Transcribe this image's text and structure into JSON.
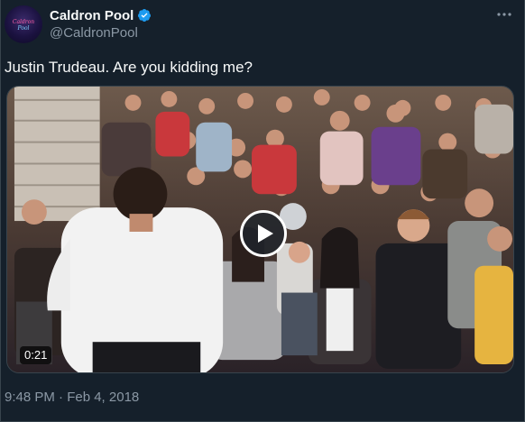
{
  "account": {
    "display_name": "Caldron Pool",
    "handle": "@CaldronPool",
    "avatar_logo_text": "Caldron Pool",
    "verified_icon": "verified-badge-icon"
  },
  "tweet": {
    "text": "Justin Trudeau. Are you kidding me?",
    "more_icon": "more-options-icon"
  },
  "video": {
    "duration": "0:21",
    "play_icon": "play-icon"
  },
  "meta": {
    "timestamp": "9:48 PM · Feb 4, 2018"
  },
  "colors": {
    "background": "#15202b",
    "primary_text": "#f7f9f9",
    "secondary_text": "#8b98a5",
    "verified_blue": "#1d9bf0",
    "border": "#38444d"
  }
}
